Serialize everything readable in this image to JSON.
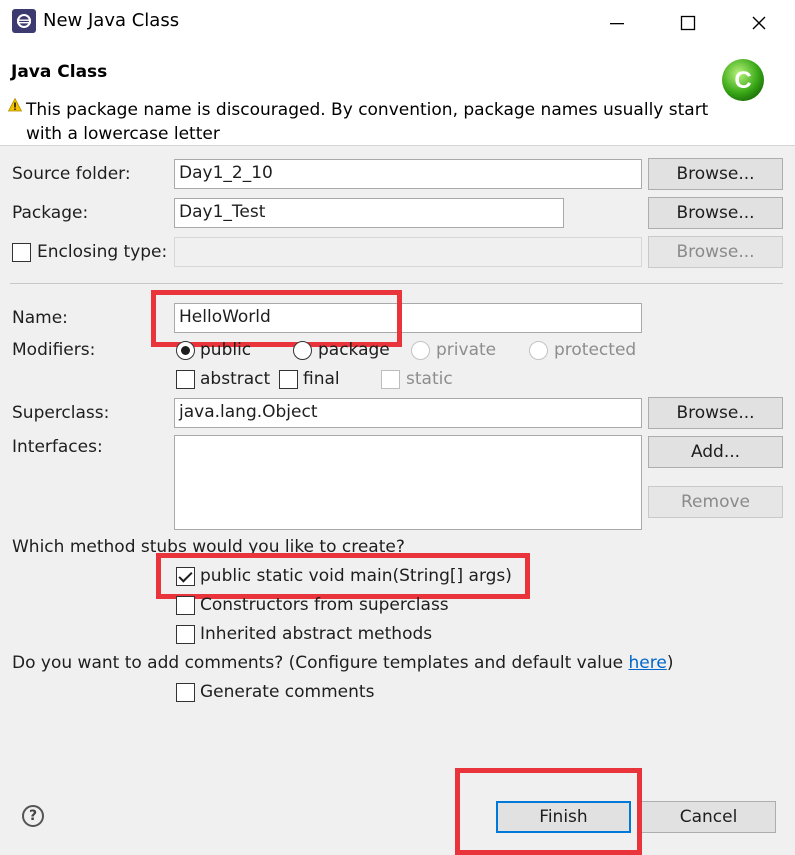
{
  "window": {
    "title": "New Java Class",
    "icon": "eclipse-icon",
    "controls": [
      "minimize-icon",
      "maximize-icon",
      "close-icon"
    ]
  },
  "header": {
    "title": "Java Class",
    "warning": "This package name is discouraged. By convention, package names usually start with a lowercase letter",
    "icon": "java-class-icon"
  },
  "form": {
    "source_folder": {
      "label": "Source folder:",
      "value": "Day1_2_10",
      "button": "Browse..."
    },
    "package": {
      "label": "Package:",
      "value": "Day1_Test",
      "button": "Browse..."
    },
    "enclosing_type": {
      "label": "Enclosing type:",
      "checked": false,
      "value": "",
      "button": "Browse..."
    },
    "name": {
      "label": "Name:",
      "value": "HelloWorld"
    },
    "modifiers": {
      "label": "Modifiers:",
      "access": [
        {
          "label": "public",
          "selected": true,
          "enabled": true
        },
        {
          "label": "package",
          "selected": false,
          "enabled": true
        },
        {
          "label": "private",
          "selected": false,
          "enabled": false
        },
        {
          "label": "protected",
          "selected": false,
          "enabled": false
        }
      ],
      "flags": [
        {
          "label": "abstract",
          "checked": false,
          "enabled": true
        },
        {
          "label": "final",
          "checked": false,
          "enabled": true
        },
        {
          "label": "static",
          "checked": false,
          "enabled": false
        }
      ]
    },
    "superclass": {
      "label": "Superclass:",
      "value": "java.lang.Object",
      "button": "Browse..."
    },
    "interfaces": {
      "label": "Interfaces:",
      "add_button": "Add...",
      "remove_button": "Remove"
    },
    "stubs": {
      "question": "Which method stubs would you like to create?",
      "options": [
        {
          "label": "public static void main(String[] args)",
          "checked": true
        },
        {
          "label": "Constructors from superclass",
          "checked": false
        },
        {
          "label": "Inherited abstract methods",
          "checked": false
        }
      ]
    },
    "comments": {
      "question_prefix": "Do you want to add comments? (Configure templates and default value ",
      "link": "here",
      "question_suffix": ")",
      "option": {
        "label": "Generate comments",
        "checked": false
      }
    }
  },
  "footer": {
    "help": "?",
    "finish": "Finish",
    "cancel": "Cancel"
  },
  "colors": {
    "highlight": "#e8343a",
    "link": "#0066cc",
    "panel": "#f0f0f0",
    "default_button_border": "#0078d7"
  }
}
